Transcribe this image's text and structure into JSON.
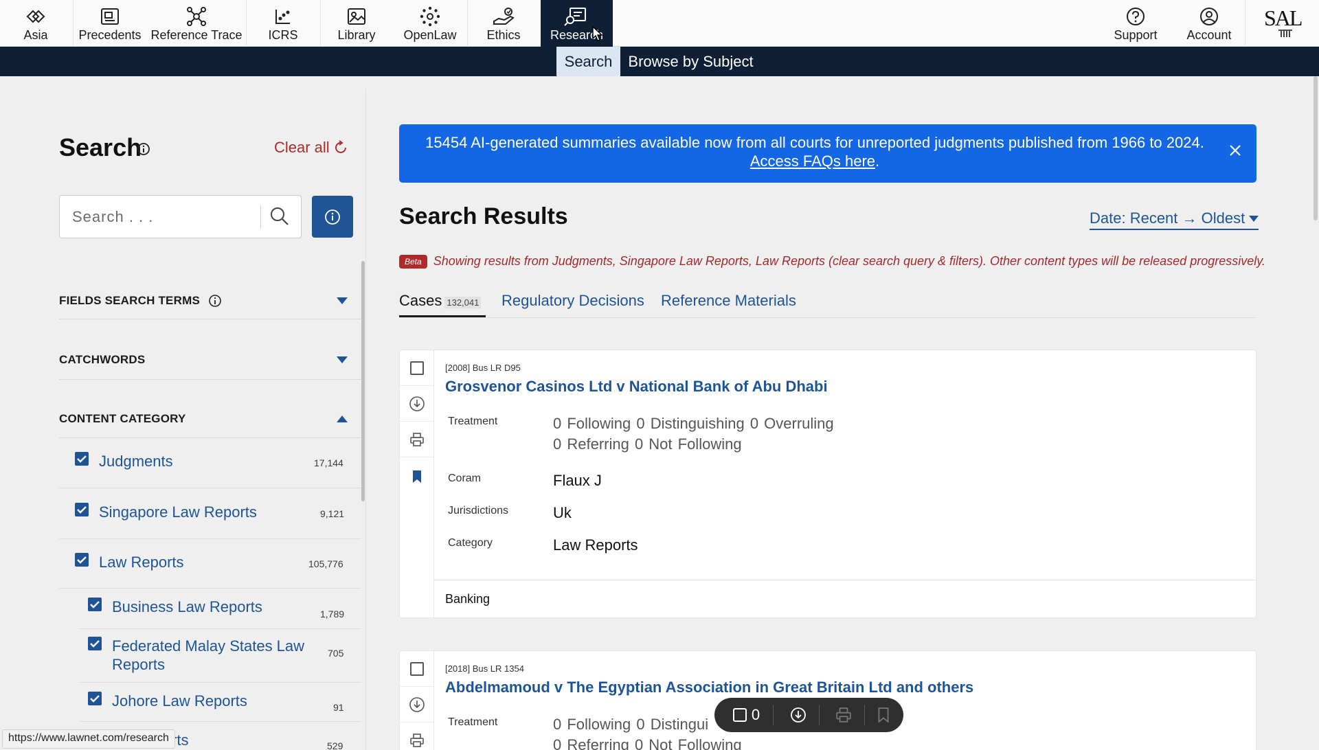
{
  "nav": {
    "items": [
      {
        "label": "Asia",
        "icon": "asia-icon"
      },
      {
        "label": "Precedents",
        "icon": "precedents-icon"
      },
      {
        "label": "Reference Trace",
        "icon": "reference-trace-icon"
      },
      {
        "label": "ICRS",
        "icon": "icrs-icon"
      },
      {
        "label": "Library",
        "icon": "library-icon"
      },
      {
        "label": "OpenLaw",
        "icon": "openlaw-icon"
      },
      {
        "label": "Ethics",
        "icon": "ethics-icon"
      },
      {
        "label": "Research",
        "icon": "research-icon"
      }
    ],
    "active": "Research",
    "right_items": [
      {
        "label": "Support",
        "icon": "question-circle-icon"
      },
      {
        "label": "Account",
        "icon": "user-circle-icon"
      }
    ],
    "logo": "SAL",
    "accent": "#0e1f36"
  },
  "subnav": {
    "tabs": [
      "Search",
      "Browse by Subject"
    ],
    "active": "Search"
  },
  "sidebar": {
    "title": "Search",
    "clear_all": "Clear all",
    "search_placeholder": "Search . . .",
    "filters": {
      "fields": "FIELDS SEARCH TERMS",
      "catchwords": "CATCHWORDS",
      "content_category": "CONTENT CATEGORY"
    },
    "categories": [
      {
        "label": "Judgments",
        "count": "17,144",
        "checked": true
      },
      {
        "label": "Singapore Law Reports",
        "count": "9,121",
        "checked": true
      },
      {
        "label": "Law Reports",
        "count": "105,776",
        "checked": true
      }
    ],
    "subcategories": [
      {
        "label": "Business Law Reports",
        "count": "1,789",
        "checked": true
      },
      {
        "label": "Federated Malay States Law",
        "label2": "Reports",
        "count": "705",
        "checked": true
      },
      {
        "label": "Johore Law Reports",
        "count": "91",
        "checked": true
      },
      {
        "label": "rts",
        "count": "529",
        "checked": true
      }
    ]
  },
  "banner": {
    "text": "15454 AI-generated summaries available now from all courts for unreported judgments published from 1966 to 2024.",
    "link": "Access FAQs here",
    "link_suffix": ".",
    "color": "#1467e4"
  },
  "results": {
    "title": "Search Results",
    "sort": "Date: Recent → Oldest",
    "beta_badge": "Beta",
    "beta_text": "Showing results from Judgments, Singapore Law Reports, Law Reports (clear search query & filters). Other content types will be released progressively.",
    "tabs": [
      {
        "label": "Cases",
        "count": "132,041"
      },
      {
        "label": "Regulatory Decisions"
      },
      {
        "label": "Reference Materials"
      }
    ],
    "cards": [
      {
        "citation": "[2008] Bus LR D95",
        "title": "Grosvenor Casinos Ltd v National Bank of Abu Dhabi",
        "treatment_label": "Treatment",
        "treatment_line1": "0 Following   0 Distinguishing   0 Overruling",
        "treatment_line2": "0 Referring   0 Not Following",
        "coram_label": "Coram",
        "coram": "Flaux J",
        "jurisdictions_label": "Jurisdictions",
        "jurisdictions": "Uk",
        "category_label": "Category",
        "category": "Law Reports",
        "subject": "Banking"
      },
      {
        "citation": "[2018] Bus LR 1354",
        "title": "Abdelmamoud v The Egyptian Association in Great Britain Ltd and others",
        "treatment_label": "Treatment",
        "treatment_line1": "0 Following   0 Distingui",
        "treatment_line2": "0 Referring   0 Not Following"
      }
    ]
  },
  "floatbar": {
    "selected_count": "0"
  },
  "status_url": "https://www.lawnet.com/research"
}
